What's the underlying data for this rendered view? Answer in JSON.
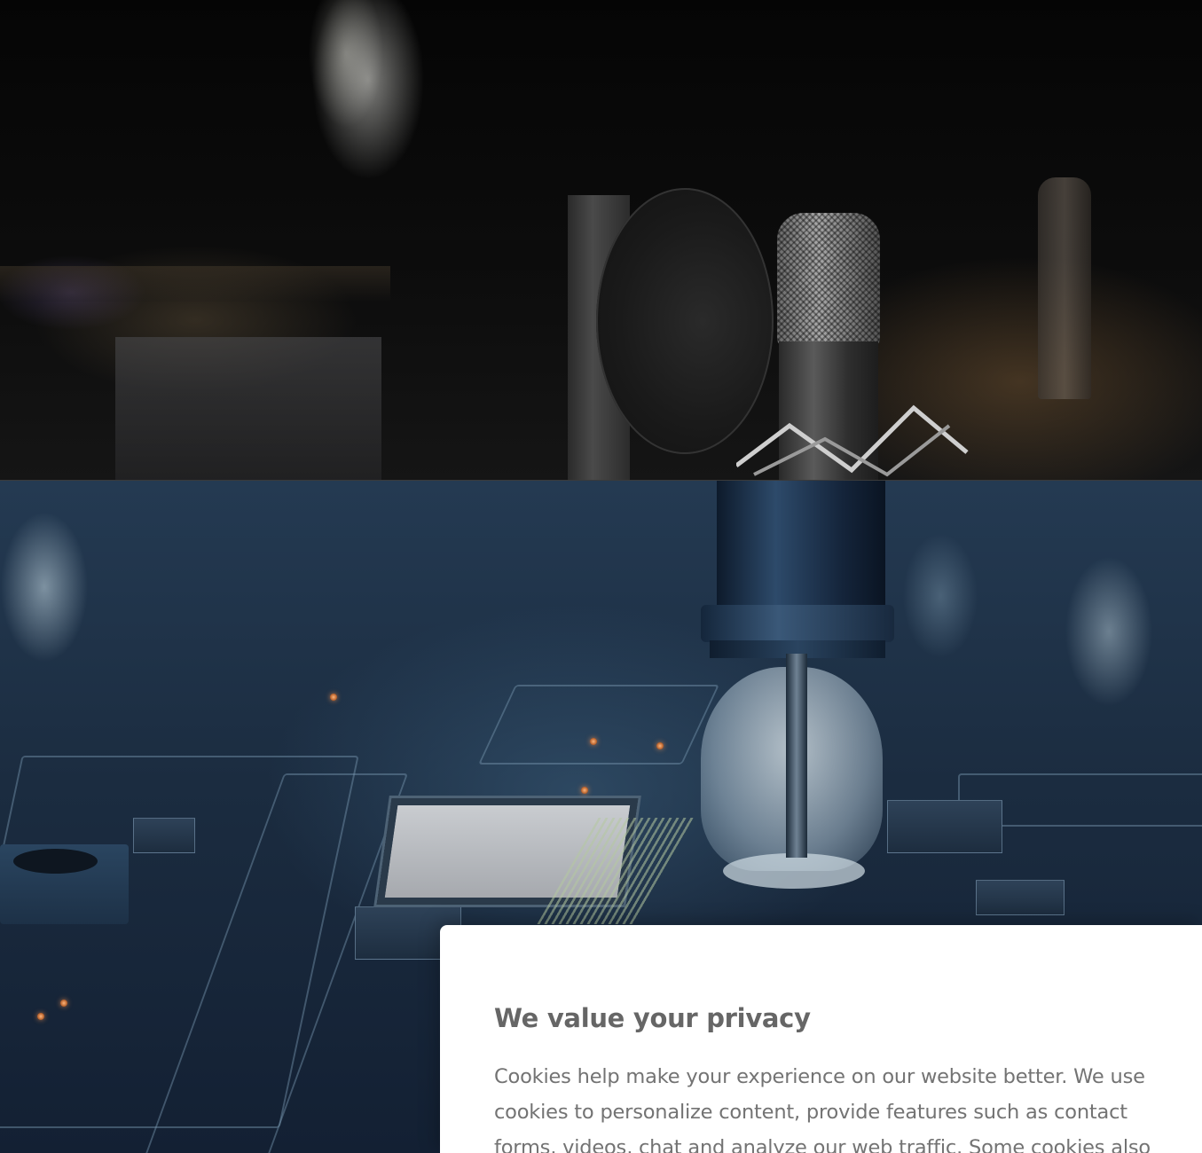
{
  "hero_images": [
    {
      "subject": "studio-microphone"
    },
    {
      "subject": "circuit-board-robotic-gripper"
    }
  ],
  "cookie_dialog": {
    "title": "We value your privacy",
    "body": "Cookies help make your experience on our website better. We use cookies to personalize content, provide features such as contact forms, videos, chat and analyze our web traffic. Some cookies also"
  },
  "colors": {
    "dialog_background": "#ffffff",
    "dialog_title": "#666666",
    "dialog_text": "#737373",
    "page_background": "#0b0f15"
  }
}
